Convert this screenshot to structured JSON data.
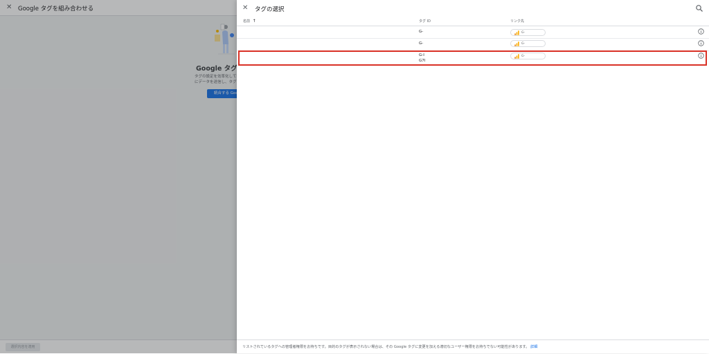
{
  "background": {
    "title": "Google タグを組み合わせる",
    "heading": "Google タグ",
    "description_lines": [
      "タグの設定を効率化して簡",
      "にデータを送信し、タグ"
    ],
    "primary_button": "統合する Goo",
    "footer_button": "選択内容を適用"
  },
  "panel": {
    "title": "タグの選択",
    "columns": {
      "name": "名前",
      "tag_id": "タグ ID",
      "link": "リンク先"
    },
    "rows": [
      {
        "tag_id_line1": "G-",
        "tag_id_line2": "",
        "link_label": "G-"
      },
      {
        "tag_id_line1": "G-",
        "tag_id_line2": "",
        "link_label": "G-"
      },
      {
        "tag_id_line1": "G-I",
        "tag_id_line2": "G7I",
        "link_label": "G-"
      }
    ],
    "footer_text": "リストされているタグへの管理者権限をお持ちです。目的のタグが表示されない場合は、その Google タグに変更を加える適切なユーザー権限をお持ちでない可能性があります。",
    "footer_link": "詳細"
  },
  "colors": {
    "accent": "#1a73e8",
    "highlight": "#d93025",
    "analytics_orange": "#f9ab00",
    "analytics_dark": "#e37400"
  }
}
